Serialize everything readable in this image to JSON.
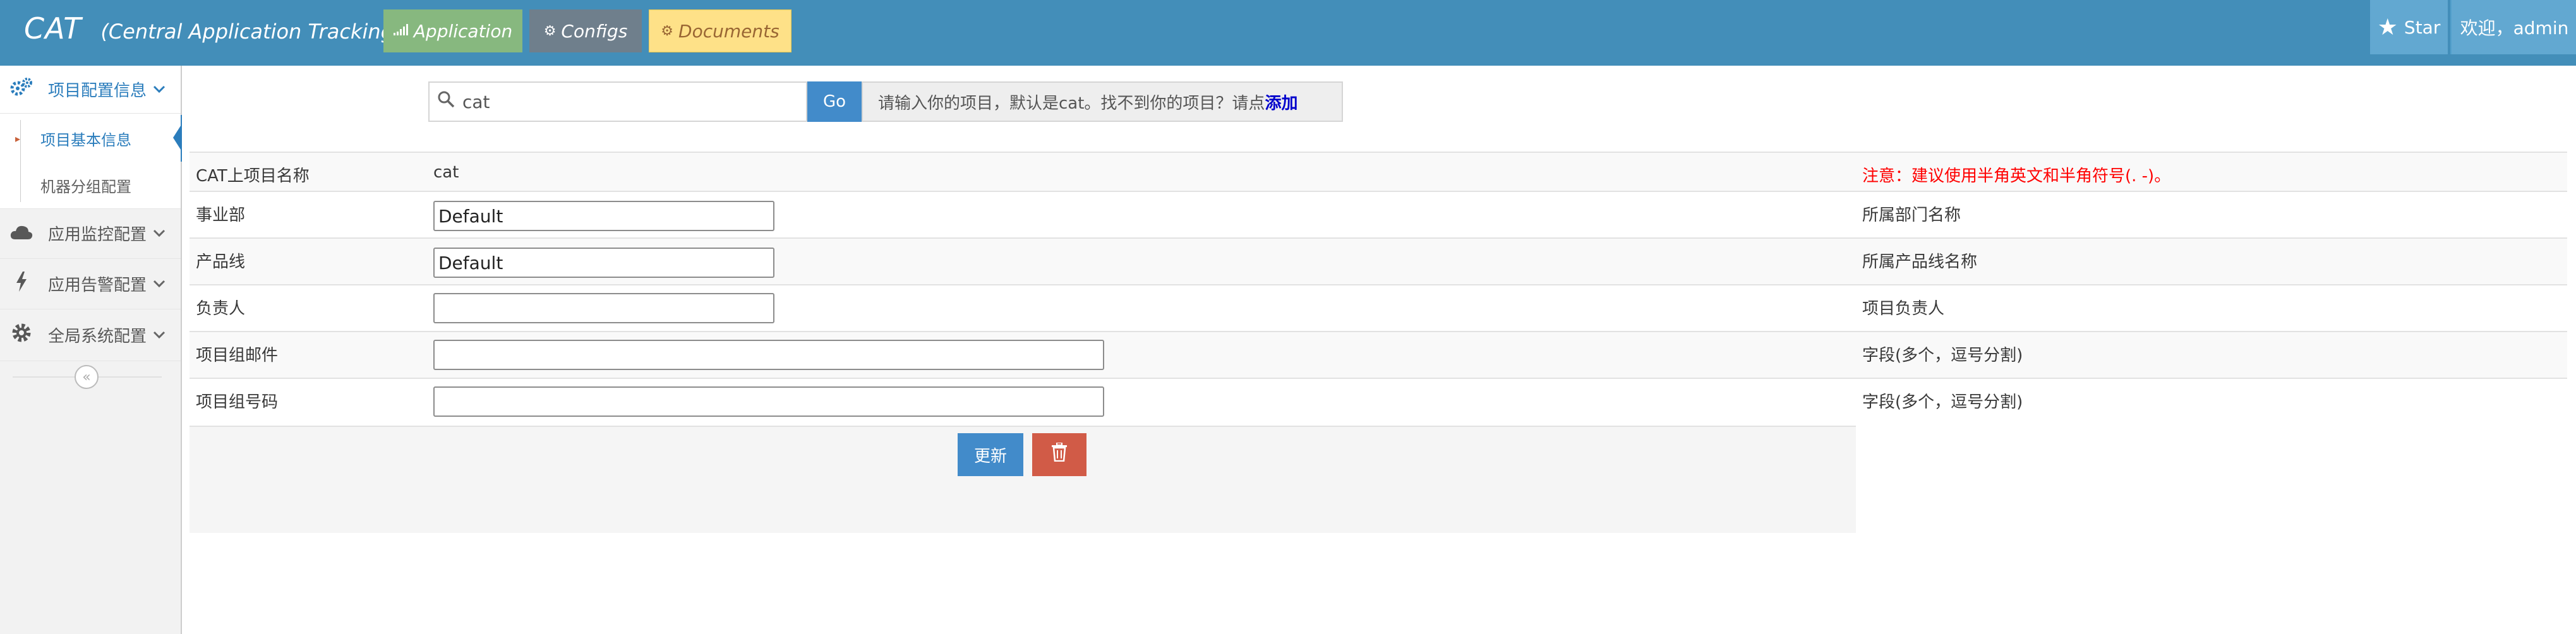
{
  "navbar": {
    "brand_title": "CAT",
    "brand_subtitle": "(Central Application Tracking)",
    "buttons": [
      {
        "icon": "bar-chart-icon",
        "label": "Application"
      },
      {
        "icon": "cogs-icon",
        "label": "Configs"
      },
      {
        "icon": "cogs-icon",
        "label": "Documents"
      }
    ],
    "star_label": "Star",
    "welcome_text": "欢迎，admin"
  },
  "sidebar": {
    "groups": [
      {
        "icon": "cogs-icon",
        "label": "项目配置信息",
        "expanded": true,
        "items": [
          {
            "label": "项目基本信息",
            "active": true
          },
          {
            "label": "机器分组配置",
            "active": false
          }
        ]
      },
      {
        "icon": "cloud-icon",
        "label": "应用监控配置",
        "expanded": false
      },
      {
        "icon": "bolt-icon",
        "label": "应用告警配置",
        "expanded": false
      },
      {
        "icon": "gear-icon",
        "label": "全局系统配置",
        "expanded": false
      }
    ],
    "collapse_icon": "double-angle-left-icon"
  },
  "search": {
    "value": "cat",
    "go_label": "Go",
    "hint_text": "请输入你的项目，默认是cat。找不到你的项目？请点",
    "hint_link": "添加"
  },
  "form": {
    "rows": [
      {
        "label": "CAT上项目名称",
        "value": "cat",
        "note": "注意：建议使用半角英文和半角符号(. -)。"
      },
      {
        "label": "事业部",
        "value": "Default",
        "note": "所属部门名称"
      },
      {
        "label": "产品线",
        "value": "Default",
        "note": "所属产品线名称"
      },
      {
        "label": "负责人",
        "value": "",
        "note": "项目负责人"
      },
      {
        "label": "项目组邮件",
        "value": "",
        "note": "字段(多个，逗号分割)"
      },
      {
        "label": "项目组号码",
        "value": "",
        "note": "字段(多个，逗号分割)"
      }
    ],
    "update_label": "更新",
    "delete_icon": "trash-icon"
  },
  "colors": {
    "navbar_bg": "#438eb9",
    "application_btn": "#87b87f",
    "configs_btn": "#6f7f8c",
    "documents_btn": "#fee188",
    "primary": "#428bca",
    "danger": "#d15b47",
    "warning_text": "#ff0000"
  }
}
